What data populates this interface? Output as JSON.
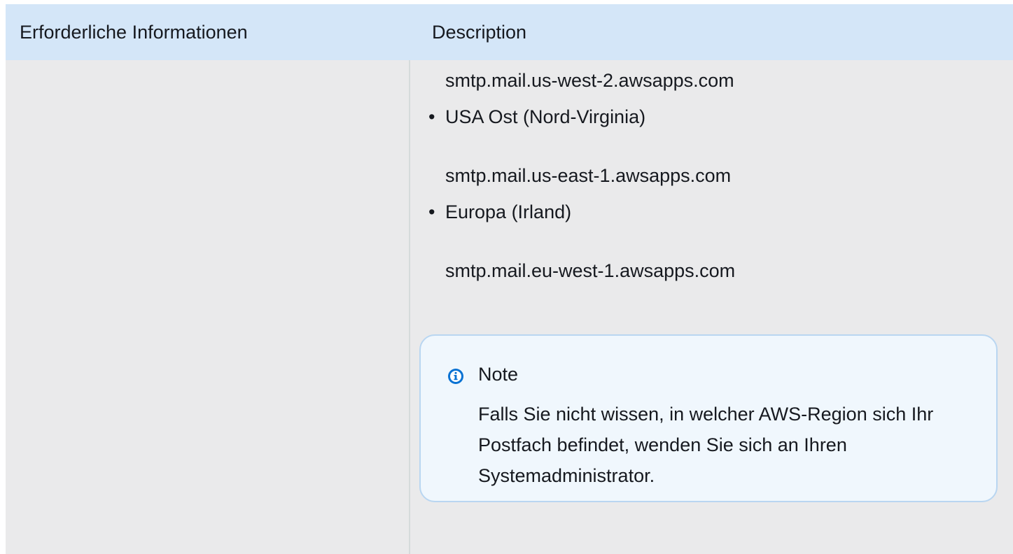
{
  "table": {
    "headers": [
      "Erforderliche Informationen",
      "Description"
    ],
    "description_lines": {
      "host_us_west_2": "smtp.mail.us-west-2.awsapps.com",
      "region_us_east": "USA Ost (Nord-Virginia)",
      "host_us_east_1": "smtp.mail.us-east-1.awsapps.com",
      "region_eu": "Europa (Irland)",
      "host_eu_west_1": "smtp.mail.eu-west-1.awsapps.com"
    },
    "bullet_glyph": "•"
  },
  "note": {
    "icon": "info-icon",
    "title": "Note",
    "text": "Falls Sie nicht wissen, in welcher AWS-Region sich Ihr Postfach befindet, wenden Sie sich an Ihren Systemadministrator.",
    "accent_color": "#0972d3"
  }
}
